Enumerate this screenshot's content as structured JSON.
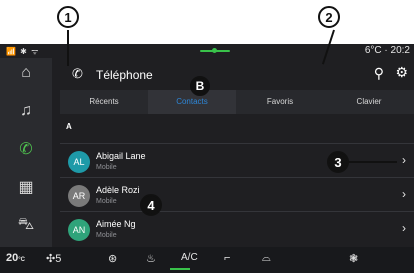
{
  "status": {
    "left_icons": "📶 ✱ ᯤ",
    "right": "6°C · 20:2"
  },
  "header": {
    "title": "Téléphone"
  },
  "tabs": [
    "Récents",
    "Contacts",
    "Favoris",
    "Clavier"
  ],
  "index_letter": "A",
  "contacts": [
    {
      "initials": "AL",
      "name": "Abigail Lane",
      "type": "Mobile",
      "color": "#1e9aa8"
    },
    {
      "initials": "AR",
      "name": "Adèle Rozi",
      "type": "Mobile",
      "color": "#7a7a7a"
    },
    {
      "initials": "AN",
      "name": "Aimée Ng",
      "type": "Mobile",
      "color": "#2fa37a"
    }
  ],
  "climate": {
    "temp_left": "20",
    "temp_left_unit": "°C",
    "fan": "5"
  },
  "callouts": {
    "c1": "1",
    "c2": "2",
    "c3": "3",
    "c4": "4",
    "cB": "B"
  },
  "colors": {
    "accent_green": "#39c24a",
    "tab_active": "#2e86d6"
  }
}
